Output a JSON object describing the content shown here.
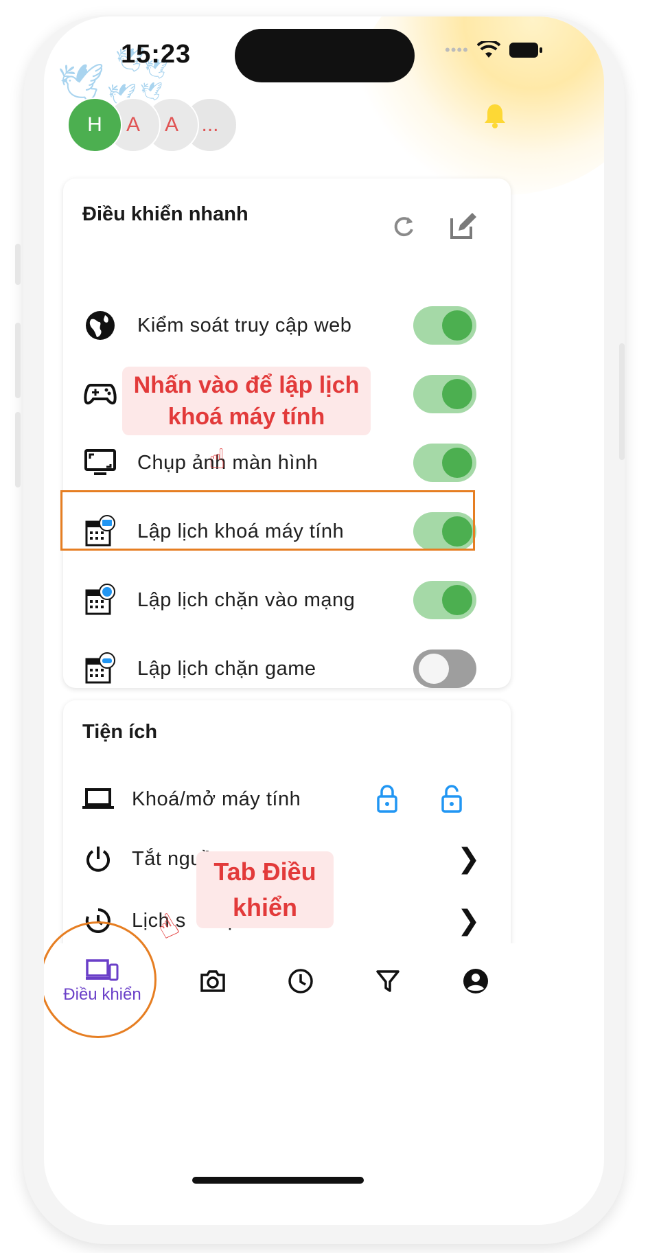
{
  "status_bar": {
    "time": "15:23"
  },
  "avatars": [
    {
      "initial": "H",
      "kind": "main"
    },
    {
      "initial": "A",
      "kind": "sub"
    },
    {
      "initial": "A",
      "kind": "sub"
    },
    {
      "initial": "...",
      "kind": "more"
    }
  ],
  "quick_controls": {
    "title": "Điều khiển nhanh",
    "refresh_icon": "refresh-icon",
    "edit_icon": "edit-icon",
    "items": [
      {
        "label": "Kiểm soát truy cập web",
        "icon": "globe-icon",
        "enabled": true
      },
      {
        "label": "",
        "icon": "gamepad-icon",
        "enabled": true
      },
      {
        "label": "Chụp ảnh màn hình",
        "icon": "monitor-icon",
        "enabled": true
      },
      {
        "label": "Lập lịch khoá máy tính",
        "icon": "calendar-lock-icon",
        "enabled": true
      },
      {
        "label": "Lập lịch chặn vào mạng",
        "icon": "calendar-globe-icon",
        "enabled": true
      },
      {
        "label": "Lập lịch chặn game",
        "icon": "calendar-game-icon",
        "enabled": false
      }
    ]
  },
  "utilities": {
    "title": "Tiện ích",
    "items": [
      {
        "label": "Khoá/mở máy tính",
        "icon": "laptop-icon"
      },
      {
        "label": "Tắt nguồ",
        "icon": "power-icon"
      },
      {
        "label": "Lịch s",
        "label_tail": "ệ",
        "icon": "history-icon"
      }
    ]
  },
  "annotations": {
    "schedule_hint": "Nhấn vào để lập lịch khoá máy tính",
    "tab_hint": "Tab Điều khiển"
  },
  "bottom_nav": {
    "active_label": "Điều khiển",
    "items": [
      "devices-icon",
      "camera-icon",
      "clock-icon",
      "filter-icon",
      "account-icon"
    ]
  },
  "colors": {
    "accent_green": "#4caf50",
    "toggle_track_on": "#a5d9a7",
    "highlight_orange": "#e67e22",
    "annotation_red": "#e23a3a",
    "nav_active": "#6a3fc8",
    "lock_blue": "#2196f3",
    "bell_yellow": "#fdd835"
  }
}
